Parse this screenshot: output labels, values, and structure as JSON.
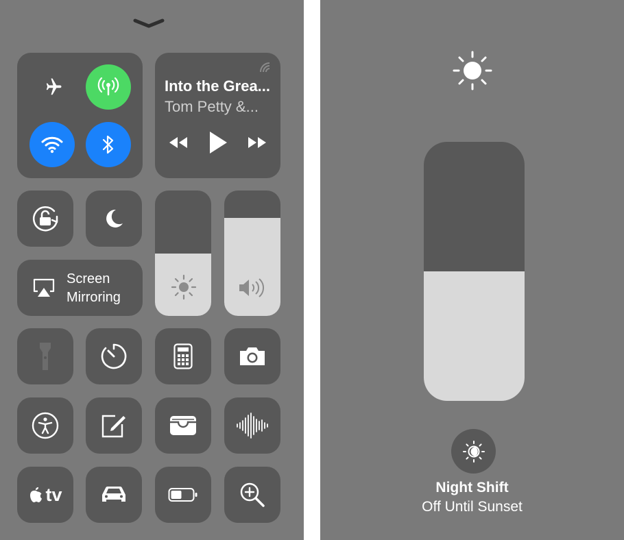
{
  "control_center": {
    "dismiss_icon": "chevron-down-icon",
    "connectivity": {
      "airplane": {
        "icon": "airplane-icon",
        "active": false
      },
      "cellular": {
        "icon": "antenna-icon",
        "active": true,
        "color": "#4cd964"
      },
      "wifi": {
        "icon": "wifi-icon",
        "active": true,
        "color": "#1a82fb"
      },
      "bluetooth": {
        "icon": "bluetooth-icon",
        "active": true,
        "color": "#1a82fb"
      }
    },
    "now_playing": {
      "title": "Into the Grea...",
      "artist": "Tom Petty &...",
      "airplay_icon": "airplay-audio-icon",
      "controls": [
        "rewind-icon",
        "play-icon",
        "fast-forward-icon"
      ]
    },
    "orientation_lock": {
      "icon": "orientation-lock-icon"
    },
    "do_not_disturb": {
      "icon": "moon-icon"
    },
    "screen_mirroring": {
      "line1": "Screen",
      "line2": "Mirroring",
      "icon": "airplay-screen-icon"
    },
    "brightness": {
      "icon": "sun-icon",
      "level": 0.5
    },
    "volume": {
      "icon": "speaker-icon",
      "level": 0.78
    },
    "shortcuts_row1": [
      "flashlight-icon",
      "timer-icon",
      "calculator-icon",
      "camera-icon"
    ],
    "shortcuts_row2": [
      "accessibility-icon",
      "notes-icon",
      "wallet-icon",
      "voice-memos-icon"
    ],
    "shortcuts_row3": {
      "apple_tv_label": "tv",
      "icons": [
        "apple-tv-icon",
        "car-icon",
        "low-power-icon",
        "magnifier-icon"
      ]
    }
  },
  "brightness_detail": {
    "icon": "sun-icon",
    "level": 0.5,
    "night_shift": {
      "icon": "night-shift-icon",
      "title": "Night Shift",
      "status": "Off Until Sunset"
    }
  },
  "colors": {
    "panel_bg": "#7a7a7a",
    "tile_bg": "#585858",
    "slider_fill": "#d9d9d9",
    "green": "#4cd964",
    "blue": "#1a82fb"
  }
}
